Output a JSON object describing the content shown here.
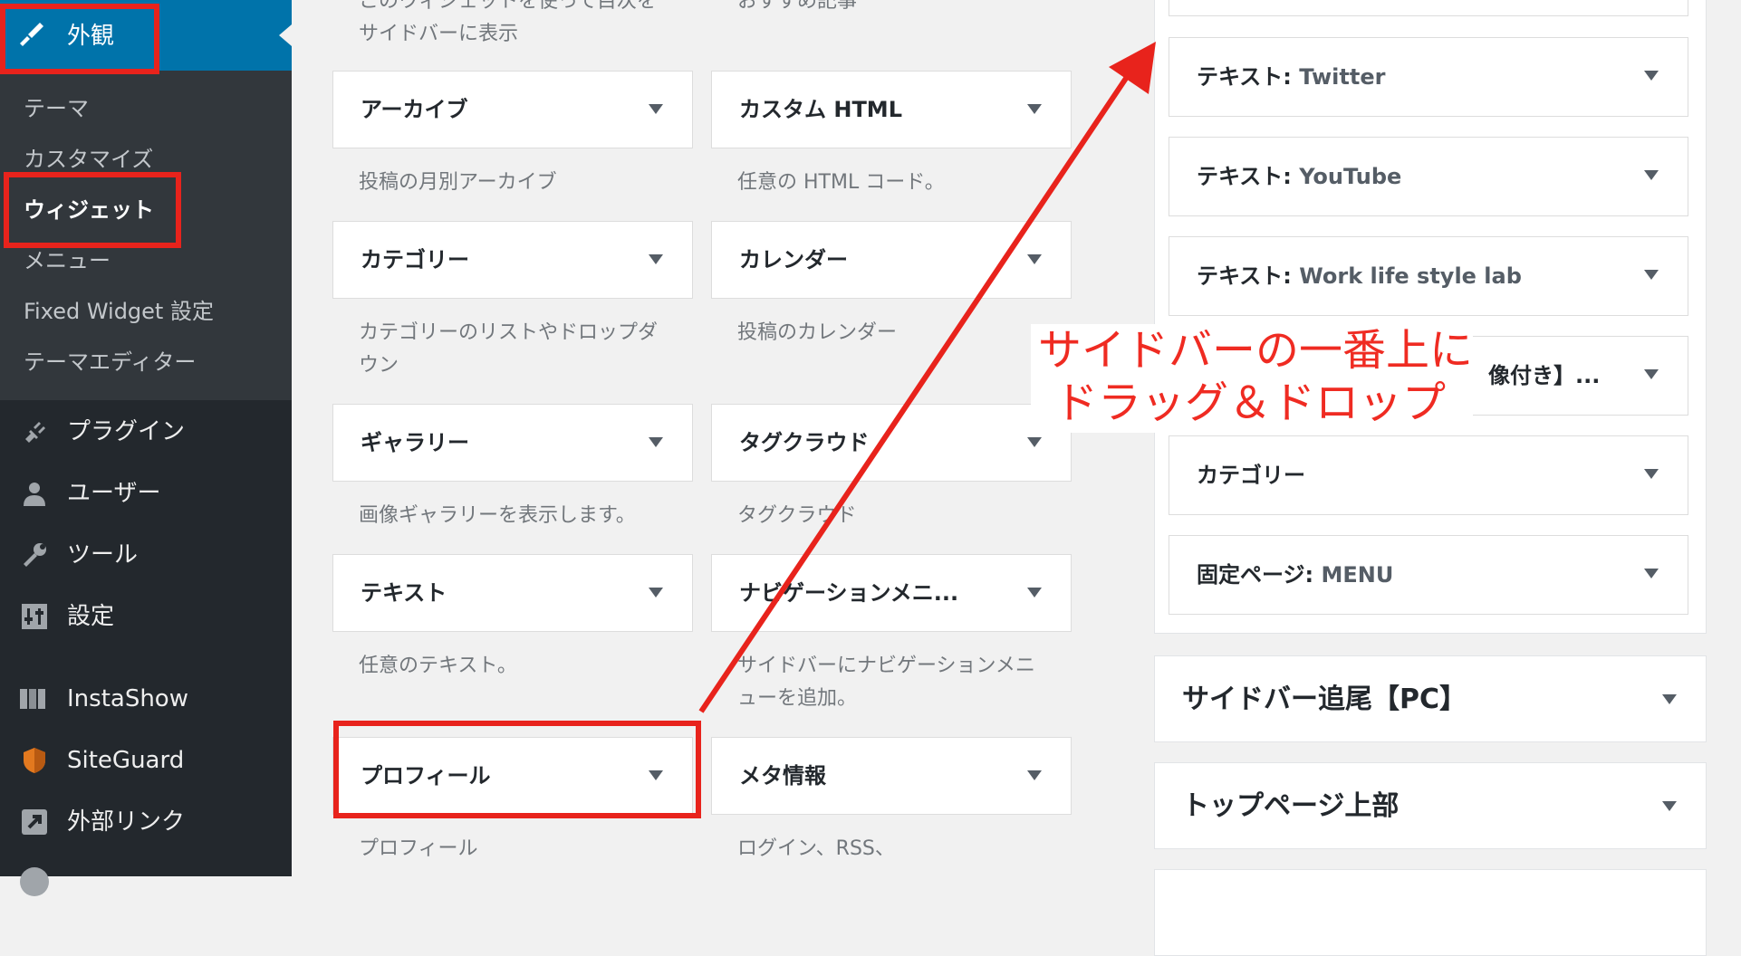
{
  "sidebar": {
    "active": {
      "label": "外観",
      "icon": "paintbrush-icon"
    },
    "submenu": [
      "テーマ",
      "カスタマイズ",
      "ウィジェット",
      "メニュー",
      "Fixed Widget 設定",
      "テーマエディター"
    ],
    "items": [
      {
        "label": "プラグイン",
        "icon": "plugin-icon"
      },
      {
        "label": "ユーザー",
        "icon": "user-icon"
      },
      {
        "label": "ツール",
        "icon": "wrench-icon"
      },
      {
        "label": "設定",
        "icon": "settings-icon"
      },
      {
        "label": "InstaShow",
        "icon": "instashow-icon"
      },
      {
        "label": "SiteGuard",
        "icon": "shield-icon"
      },
      {
        "label": "外部リンク",
        "icon": "external-link-icon"
      }
    ]
  },
  "widgets": {
    "top_descs": [
      "このウィジェットを使って目次を\nサイドバーに表示",
      "おすすめ記事"
    ],
    "items": [
      {
        "title": "アーカイブ",
        "desc": "投稿の月別アーカイブ"
      },
      {
        "title": "カスタム HTML",
        "desc": "任意の HTML コード。"
      },
      {
        "title": "カテゴリー",
        "desc": "カテゴリーのリストやドロップダ\nウン"
      },
      {
        "title": "カレンダー",
        "desc": "投稿のカレンダー"
      },
      {
        "title": "ギャラリー",
        "desc": "画像ギャラリーを表示します。"
      },
      {
        "title": "タグクラウド",
        "desc": "タグクラウド"
      },
      {
        "title": "テキスト",
        "desc": "任意のテキスト。"
      },
      {
        "title": "ナビゲーションメニ...",
        "desc": "サイドバーにナビゲーションメニ\nューを追加。"
      },
      {
        "title": "プロフィール",
        "desc": "プロフィール"
      },
      {
        "title": "メタ情報",
        "desc": "ログイン、RSS、"
      }
    ]
  },
  "sidebar_area": {
    "widgets": [
      {
        "prefix": "テキスト:",
        "name": "Twitter"
      },
      {
        "prefix": "テキスト:",
        "name": "YouTube"
      },
      {
        "prefix": "テキスト:",
        "name": "Work life style lab"
      },
      {
        "prefix": "",
        "name": "像付き】..."
      },
      {
        "prefix": "",
        "name": "カテゴリー"
      },
      {
        "prefix": "固定ページ:",
        "name": "MENU"
      }
    ],
    "areas": [
      "サイドバー追尾【PC】",
      "トップページ上部"
    ]
  },
  "annotation": {
    "lines": [
      "サイドバーの一番上に",
      "ドラッグ＆ドロップ"
    ],
    "color": "#e8231c"
  },
  "colors": {
    "admin_bar": "#23282d",
    "submenu": "#32373c",
    "active": "#0073aa",
    "page_bg": "#f1f1f1"
  }
}
